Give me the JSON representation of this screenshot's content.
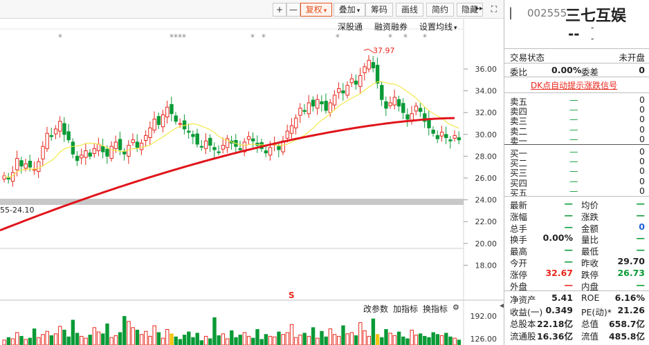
{
  "toolbar": {
    "plus": "+",
    "minus": "—",
    "fuquan": "复权",
    "diejia": "叠加",
    "chouma": "筹码",
    "huaxian": "画线",
    "jianyue": "简约",
    "yincang": "隐藏",
    "more": "▸▸",
    "fullscreen": "⛶"
  },
  "chart_toolbar": {
    "shengutong": "深股通",
    "rongzi": "融资融券",
    "junxian": "设置均线"
  },
  "indicator_toolbar": {
    "gaicanshu": "改参数",
    "jiazhibiao": "加指标",
    "huanzhibiao": "换指标"
  },
  "price_axis": [
    "36.00",
    "34.00",
    "32.00",
    "30.00",
    "28.00",
    "26.00",
    "24.00",
    "22.00",
    "20.00",
    "18.00"
  ],
  "volume_axis": [
    "192.00",
    "126.00"
  ],
  "price_label": "24.10",
  "price_label_prefix": "55",
  "high_label": "37.97",
  "star_marks": [
    "*",
    "****",
    "*",
    "*",
    "*",
    "*",
    "*"
  ],
  "s_mark": "S",
  "stock": {
    "code": "002555",
    "name": "三七互娱",
    "price": "--",
    "change": "-",
    "change2": "-"
  },
  "trade": {
    "status_label": "交易状态",
    "status_value": "未开盘",
    "weibi_label": "委比",
    "weibi_value": "0.00%",
    "weicha_label": "委差",
    "weicha_value": "0",
    "dk_label": "DK点自动提示涨跌信号"
  },
  "order_book": {
    "sell": [
      {
        "label": "卖五",
        "price": "—",
        "vol": "0"
      },
      {
        "label": "卖四",
        "price": "—",
        "vol": "0"
      },
      {
        "label": "卖三",
        "price": "—",
        "vol": "0"
      },
      {
        "label": "卖二",
        "price": "—",
        "vol": "0"
      },
      {
        "label": "卖一",
        "price": "—",
        "vol": "0"
      }
    ],
    "buy": [
      {
        "label": "买一",
        "price": "—",
        "vol": "0"
      },
      {
        "label": "买二",
        "price": "—",
        "vol": "0"
      },
      {
        "label": "买三",
        "price": "—",
        "vol": "0"
      },
      {
        "label": "买四",
        "price": "—",
        "vol": "0"
      },
      {
        "label": "买五",
        "price": "—",
        "vol": "0"
      }
    ]
  },
  "quote": [
    {
      "l1": "最新",
      "v1": "—",
      "l2": "均价",
      "v2": "—",
      "c2": "dash"
    },
    {
      "l1": "涨幅",
      "v1": "—",
      "l2": "涨跌",
      "v2": "—",
      "c2": "dash"
    },
    {
      "l1": "总手",
      "v1": "—",
      "l2": "金额",
      "v2": "0",
      "c2": "blue"
    },
    {
      "l1": "换手",
      "v1": "0.00%",
      "l2": "量比",
      "v2": "—",
      "c2": "dash"
    },
    {
      "l1": "最高",
      "v1": "—",
      "l2": "最低",
      "v2": "—",
      "c2": "dash"
    },
    {
      "l1": "今开",
      "v1": "—",
      "l2": "昨收",
      "v2": "29.70",
      "c2": "plain"
    },
    {
      "l1": "涨停",
      "v1": "32.67",
      "l2": "跌停",
      "v2": "26.73",
      "c2": "green",
      "c1": "red"
    },
    {
      "l1": "外盘",
      "v1": "—",
      "l2": "内盘",
      "v2": "—",
      "c2": "dash",
      "c1": "red"
    }
  ],
  "fundamentals": [
    {
      "l1": "净资产",
      "v1": "5.41",
      "l2": "ROE",
      "v2": "6.16%"
    },
    {
      "l1": "收益(一)",
      "v1": "0.349",
      "l2": "PE(动)*",
      "v2": "21.26"
    },
    {
      "l1": "总股本",
      "v1": "22.18亿",
      "l2": "总值",
      "v2": "658.7亿"
    },
    {
      "l1": "流通股",
      "v1": "16.36亿",
      "l2": "流值",
      "v2": "485.8亿"
    }
  ],
  "colors": {
    "up": "#e8261b",
    "down": "#0a9a36",
    "ma_red": "#e0141a",
    "ma_yellow": "#f3e94a",
    "accent": "#e2531f"
  }
}
